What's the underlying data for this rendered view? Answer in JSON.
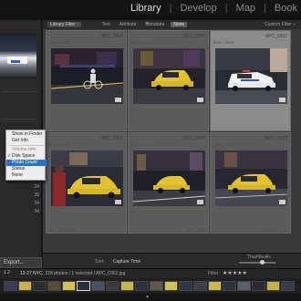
{
  "modules": [
    "Library",
    "Develop",
    "Map",
    "Book"
  ],
  "modules_sep": "|",
  "left_panel": {
    "export_label": "Export...",
    "counts": [
      "24",
      "35",
      "24",
      "34"
    ]
  },
  "filter_bar": {
    "title": "Library Filter :",
    "tabs": [
      "Text",
      "Attribute",
      "Metadata",
      "None"
    ],
    "active_tab": "None",
    "preset": "Custom Filter ÷"
  },
  "cells": [
    {
      "name": "APC_0304",
      "dims": "4032 x 3024",
      "selected": false,
      "scene": "night-cyclist"
    },
    {
      "name": "APC_0306",
      "dims": "4032 x 3024",
      "selected": false,
      "scene": "yellow-taxi"
    },
    {
      "name": "APC_0302",
      "dims": "4032 x 3024",
      "selected": true,
      "scene": "police-car"
    },
    {
      "name": "APC_0301",
      "dims": "4032 x 3024",
      "selected": false,
      "scene": "taxi-pedestrian"
    },
    {
      "name": "APC_0300",
      "dims": "4032 x 3024",
      "selected": false,
      "scene": "taxi-night"
    },
    {
      "name": "APC_0299",
      "dims": "4032 x 3024",
      "selected": false,
      "scene": "taxi-motion"
    }
  ],
  "cell_footers": [
    "APC_0305-Edit",
    "APC_0308",
    "20171227_238"
  ],
  "context_menu": {
    "items": [
      {
        "label": "Show in Finder",
        "type": "item"
      },
      {
        "label": "Get Info",
        "type": "item"
      },
      {
        "label": "Volume Info",
        "type": "header"
      },
      {
        "label": "Disk Space",
        "type": "checked"
      },
      {
        "label": "Photo Count",
        "type": "highlighted"
      },
      {
        "label": "Status",
        "type": "item"
      },
      {
        "label": "None",
        "type": "item"
      }
    ]
  },
  "toolbar": {
    "sort_label": "Sort:",
    "sort_value": "Capture Time",
    "thumbnails_label": "Thumbnails"
  },
  "filmstrip": {
    "pager": "1 2",
    "source": "12-27 NYC",
    "info": "228 photos / 1 selected / APC_0302.jpg",
    "filter_label": "Filter :",
    "stars": "★★★★★",
    "thumb_colors": [
      "#3b3f52",
      "#c9b04a",
      "#2c2c33",
      "#5a4a3a",
      "#d6c24e",
      "#2a2f3c",
      "#4b5366",
      "#3a3a3a",
      "#c7b64b",
      "#2b3342",
      "#61574a",
      "#d3c24f",
      "#303748",
      "#3f3f46",
      "#cdb84d",
      "#2d3140",
      "#58606e",
      "#2a2a30",
      "#c6b24a",
      "#363c4a"
    ],
    "selected_index": 5
  },
  "colors": {
    "highlight": "#2d6fd8",
    "taxi": "#e1c233",
    "panel": "#2a2a2a"
  }
}
